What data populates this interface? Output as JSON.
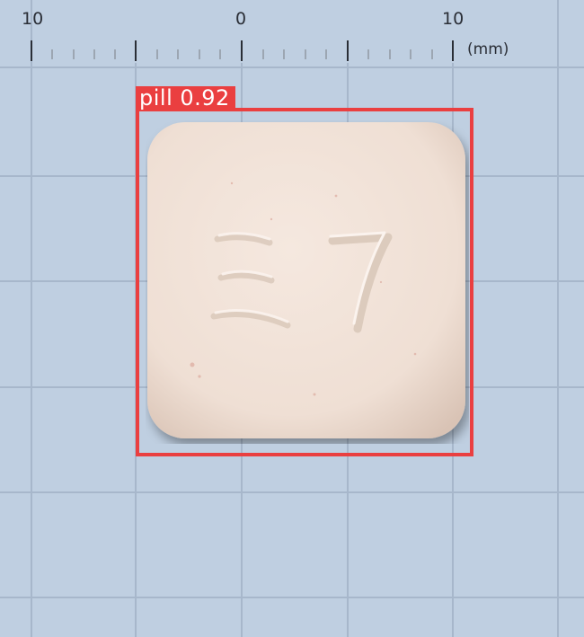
{
  "ruler": {
    "labels": [
      "10",
      "0",
      "10"
    ],
    "unit": "(mm)"
  },
  "detection": {
    "class_label": "pill",
    "confidence": "0.92",
    "box_color": "#ea3f40"
  },
  "pill": {
    "imprint": "ミ7",
    "color": "#f1e3da"
  },
  "background": {
    "color": "#bfcfe1",
    "grid_color": "#a9b8cc"
  }
}
